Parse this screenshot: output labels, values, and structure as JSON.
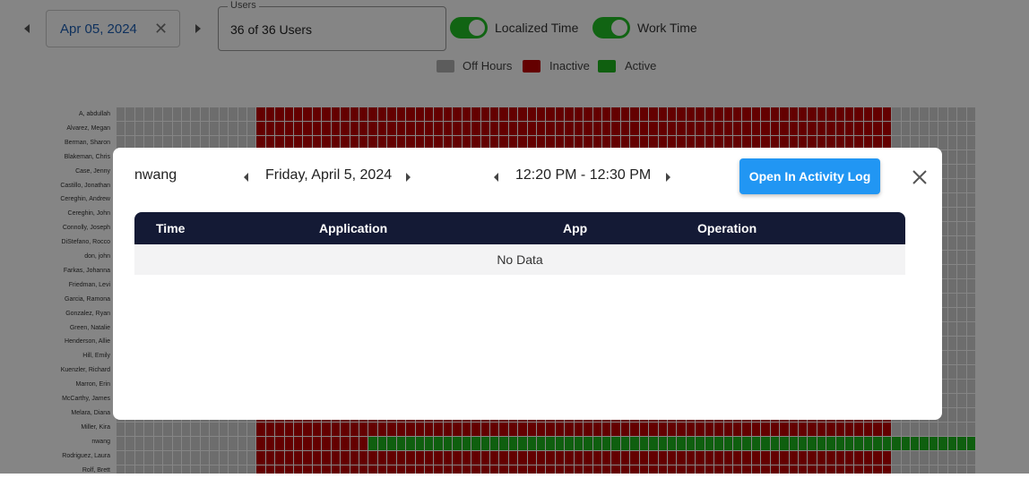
{
  "toolbar": {
    "date_value": "Apr 05, 2024",
    "clear_symbol": "✕",
    "users_label": "Users",
    "users_value": "36 of 36 Users",
    "localized_time_label": "Localized Time",
    "localized_time_on": true,
    "work_time_label": "Work Time",
    "work_time_on": true
  },
  "legend": [
    {
      "label": "Off Hours",
      "color": "#b0b0b0"
    },
    {
      "label": "Inactive",
      "color": "#c00000"
    },
    {
      "label": "Active",
      "color": "#1db71d"
    }
  ],
  "colors": {
    "off": "#d2d2d2",
    "inactive": "#c00000",
    "active": "#1db71d",
    "toggle_on": "#22c025",
    "table_header": "#141a35",
    "button": "#2196f3"
  },
  "users": [
    "A, abdullah",
    "Alvarez, Megan",
    "Berman, Sharon",
    "Blakeman, Chris",
    "Case, Jenny",
    "Castillo, Jonathan",
    "Cereghin, Andrew",
    "Cereghin, John",
    "Connolly, Joseph",
    "DiStefano, Rocco",
    "don, john",
    "Farkas, Johanna",
    "Friedman, Levi",
    "Garcia, Ramona",
    "Gonzalez, Ryan",
    "Green, Natalie",
    "Henderson, Allie",
    "Hill, Emily",
    "Kuenzler, Richard",
    "Marron, Erin",
    "McCarthy, James",
    "Melara, Diana",
    "Miller, Kira",
    "nwang",
    "Rodriguez, Laura",
    "Rolf, Brett"
  ],
  "modal": {
    "user": "nwang",
    "date": "Friday, April 5, 2024",
    "time_range": "12:20 PM - 12:30 PM",
    "open_button": "Open In Activity Log",
    "columns": [
      "Time",
      "Application",
      "App",
      "Operation"
    ],
    "empty_text": "No Data"
  }
}
